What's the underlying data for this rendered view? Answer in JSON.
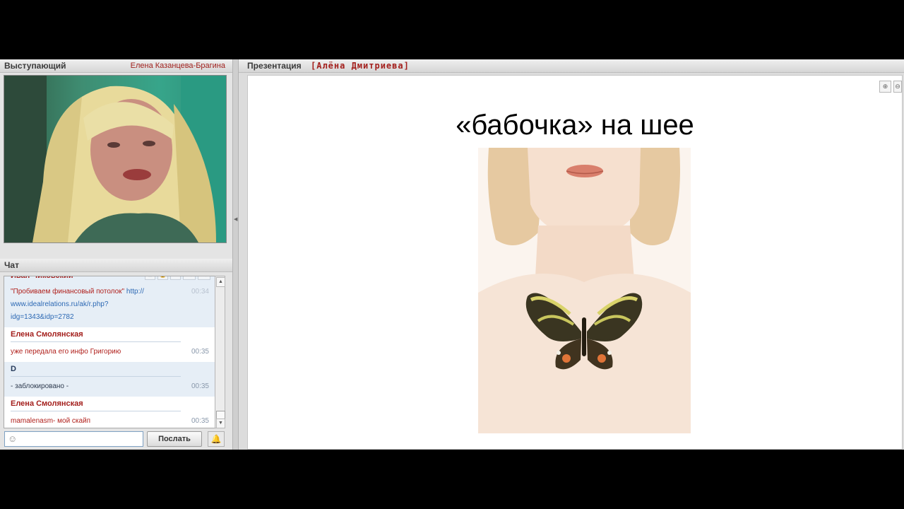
{
  "speaker_panel": {
    "title": "Выступающий",
    "speaker_name": "Елена Казанцева-Брагина"
  },
  "chat_panel": {
    "title": "Чат",
    "messages": [
      {
        "author": "Иван Чиковский",
        "text": "\"Пробиваем финансовый потолок\"",
        "link_1": "http://",
        "link_2": "www.idealrelations.ru/ak/r.php?",
        "link_3": "idg=1343&idp=2782",
        "time": "00:34"
      },
      {
        "author": "Елена Смолянская",
        "text": "уже передала его инфо Григорию",
        "time": "00:35"
      },
      {
        "author": "D",
        "text": "- заблокировано -",
        "time": "00:35"
      },
      {
        "author": "Елена Смолянская",
        "text": "mamalenasm- мой скайп",
        "time": "00:35"
      }
    ],
    "tools": [
      "⊟",
      "🔒",
      "◔",
      "T↑",
      "T↓"
    ],
    "input_placeholder": "",
    "send_label": "Послать"
  },
  "presentation_panel": {
    "title": "Презентация",
    "presenter": "[Алёна Дмитриева]",
    "slide_title": "«бабочка» на шее",
    "zoom_in_icon": "zoom-in-icon",
    "zoom_out_icon": "zoom-out-icon"
  },
  "colors": {
    "author_red": "#a31f1c",
    "link_blue": "#2d69b4",
    "alt_row": "#e6eef6"
  }
}
